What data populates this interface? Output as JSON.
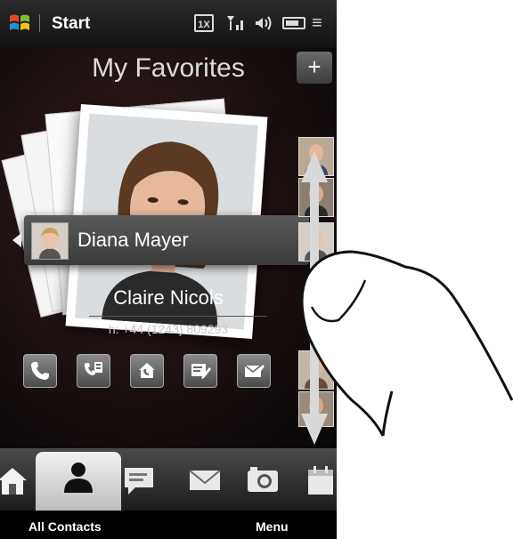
{
  "statusbar": {
    "start_label": "Start",
    "network_badge": "1X",
    "icons": [
      "windows-logo",
      "network-1x",
      "signal-bars",
      "volume",
      "battery",
      "menu-sort"
    ]
  },
  "favorites": {
    "title": "My Favorites",
    "selected_contact": "Diana Mayer",
    "current_contact": {
      "name": "Claire Nicols",
      "phone": "h: +44 (1243) 809293"
    },
    "add_label": "+",
    "actions": [
      "call-icon",
      "sms-icon",
      "home-call-icon",
      "email-compose-icon",
      "email-icon"
    ]
  },
  "tabs": [
    "home-tab",
    "people-tab",
    "messaging-tab",
    "email-tab",
    "photos-tab",
    "calendar-tab"
  ],
  "softkeys": {
    "left": "All Contacts",
    "right": "Menu"
  },
  "colors": {
    "bar_dark": "#1c1c1c",
    "active_tab": "#e6e6e6",
    "accent_red": "#c0392b"
  }
}
